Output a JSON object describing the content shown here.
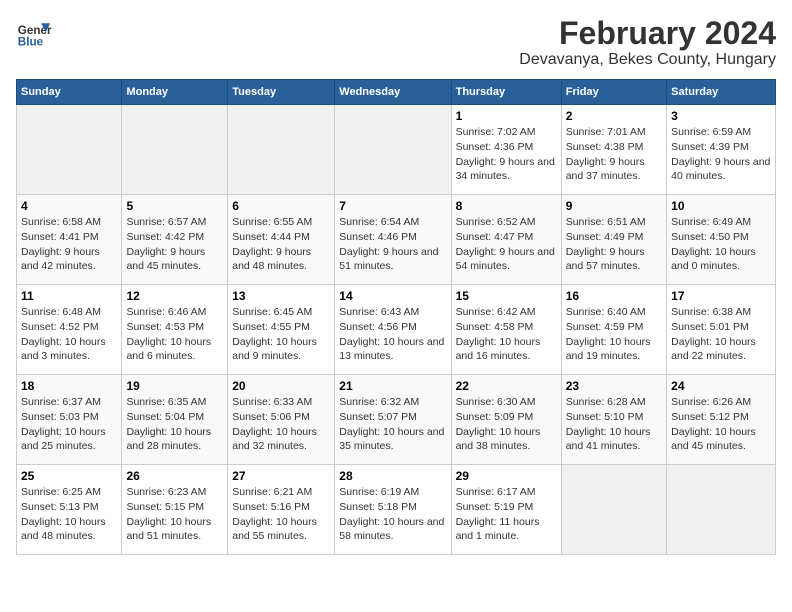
{
  "header": {
    "logo_line1": "General",
    "logo_line2": "Blue",
    "title": "February 2024",
    "subtitle": "Devavanya, Bekes County, Hungary"
  },
  "calendar": {
    "days_of_week": [
      "Sunday",
      "Monday",
      "Tuesday",
      "Wednesday",
      "Thursday",
      "Friday",
      "Saturday"
    ],
    "weeks": [
      [
        {
          "day": "",
          "info": ""
        },
        {
          "day": "",
          "info": ""
        },
        {
          "day": "",
          "info": ""
        },
        {
          "day": "",
          "info": ""
        },
        {
          "day": "1",
          "info": "Sunrise: 7:02 AM\nSunset: 4:36 PM\nDaylight: 9 hours and 34 minutes."
        },
        {
          "day": "2",
          "info": "Sunrise: 7:01 AM\nSunset: 4:38 PM\nDaylight: 9 hours and 37 minutes."
        },
        {
          "day": "3",
          "info": "Sunrise: 6:59 AM\nSunset: 4:39 PM\nDaylight: 9 hours and 40 minutes."
        }
      ],
      [
        {
          "day": "4",
          "info": "Sunrise: 6:58 AM\nSunset: 4:41 PM\nDaylight: 9 hours and 42 minutes."
        },
        {
          "day": "5",
          "info": "Sunrise: 6:57 AM\nSunset: 4:42 PM\nDaylight: 9 hours and 45 minutes."
        },
        {
          "day": "6",
          "info": "Sunrise: 6:55 AM\nSunset: 4:44 PM\nDaylight: 9 hours and 48 minutes."
        },
        {
          "day": "7",
          "info": "Sunrise: 6:54 AM\nSunset: 4:46 PM\nDaylight: 9 hours and 51 minutes."
        },
        {
          "day": "8",
          "info": "Sunrise: 6:52 AM\nSunset: 4:47 PM\nDaylight: 9 hours and 54 minutes."
        },
        {
          "day": "9",
          "info": "Sunrise: 6:51 AM\nSunset: 4:49 PM\nDaylight: 9 hours and 57 minutes."
        },
        {
          "day": "10",
          "info": "Sunrise: 6:49 AM\nSunset: 4:50 PM\nDaylight: 10 hours and 0 minutes."
        }
      ],
      [
        {
          "day": "11",
          "info": "Sunrise: 6:48 AM\nSunset: 4:52 PM\nDaylight: 10 hours and 3 minutes."
        },
        {
          "day": "12",
          "info": "Sunrise: 6:46 AM\nSunset: 4:53 PM\nDaylight: 10 hours and 6 minutes."
        },
        {
          "day": "13",
          "info": "Sunrise: 6:45 AM\nSunset: 4:55 PM\nDaylight: 10 hours and 9 minutes."
        },
        {
          "day": "14",
          "info": "Sunrise: 6:43 AM\nSunset: 4:56 PM\nDaylight: 10 hours and 13 minutes."
        },
        {
          "day": "15",
          "info": "Sunrise: 6:42 AM\nSunset: 4:58 PM\nDaylight: 10 hours and 16 minutes."
        },
        {
          "day": "16",
          "info": "Sunrise: 6:40 AM\nSunset: 4:59 PM\nDaylight: 10 hours and 19 minutes."
        },
        {
          "day": "17",
          "info": "Sunrise: 6:38 AM\nSunset: 5:01 PM\nDaylight: 10 hours and 22 minutes."
        }
      ],
      [
        {
          "day": "18",
          "info": "Sunrise: 6:37 AM\nSunset: 5:03 PM\nDaylight: 10 hours and 25 minutes."
        },
        {
          "day": "19",
          "info": "Sunrise: 6:35 AM\nSunset: 5:04 PM\nDaylight: 10 hours and 28 minutes."
        },
        {
          "day": "20",
          "info": "Sunrise: 6:33 AM\nSunset: 5:06 PM\nDaylight: 10 hours and 32 minutes."
        },
        {
          "day": "21",
          "info": "Sunrise: 6:32 AM\nSunset: 5:07 PM\nDaylight: 10 hours and 35 minutes."
        },
        {
          "day": "22",
          "info": "Sunrise: 6:30 AM\nSunset: 5:09 PM\nDaylight: 10 hours and 38 minutes."
        },
        {
          "day": "23",
          "info": "Sunrise: 6:28 AM\nSunset: 5:10 PM\nDaylight: 10 hours and 41 minutes."
        },
        {
          "day": "24",
          "info": "Sunrise: 6:26 AM\nSunset: 5:12 PM\nDaylight: 10 hours and 45 minutes."
        }
      ],
      [
        {
          "day": "25",
          "info": "Sunrise: 6:25 AM\nSunset: 5:13 PM\nDaylight: 10 hours and 48 minutes."
        },
        {
          "day": "26",
          "info": "Sunrise: 6:23 AM\nSunset: 5:15 PM\nDaylight: 10 hours and 51 minutes."
        },
        {
          "day": "27",
          "info": "Sunrise: 6:21 AM\nSunset: 5:16 PM\nDaylight: 10 hours and 55 minutes."
        },
        {
          "day": "28",
          "info": "Sunrise: 6:19 AM\nSunset: 5:18 PM\nDaylight: 10 hours and 58 minutes."
        },
        {
          "day": "29",
          "info": "Sunrise: 6:17 AM\nSunset: 5:19 PM\nDaylight: 11 hours and 1 minute."
        },
        {
          "day": "",
          "info": ""
        },
        {
          "day": "",
          "info": ""
        }
      ]
    ]
  }
}
